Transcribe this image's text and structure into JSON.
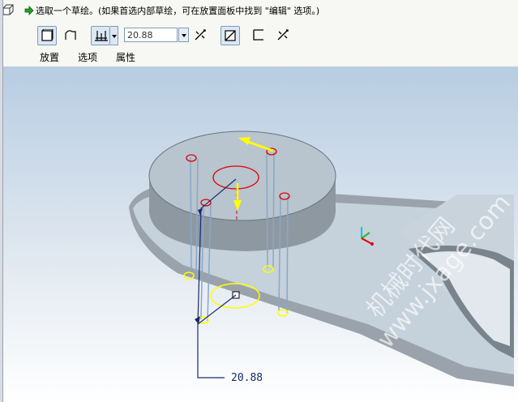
{
  "prompt": {
    "text": "选取一个草绘。(如果首选内部草绘，可在放置面板中找到 \"编辑\" 选项。)"
  },
  "dashboard": {
    "depth_value": "20.88",
    "tabs": [
      "放置",
      "选项",
      "属性"
    ]
  },
  "viewport": {
    "dimension_label": "20.88",
    "watermark_line1": "机械时代网",
    "watermark_line2": "www.jxage.com"
  },
  "colors": {
    "accent_yellow": "#ffff00",
    "hole_red": "#e00000",
    "model_gray": "#9ca6ae",
    "dimension_blue": "#1a2a6e"
  }
}
